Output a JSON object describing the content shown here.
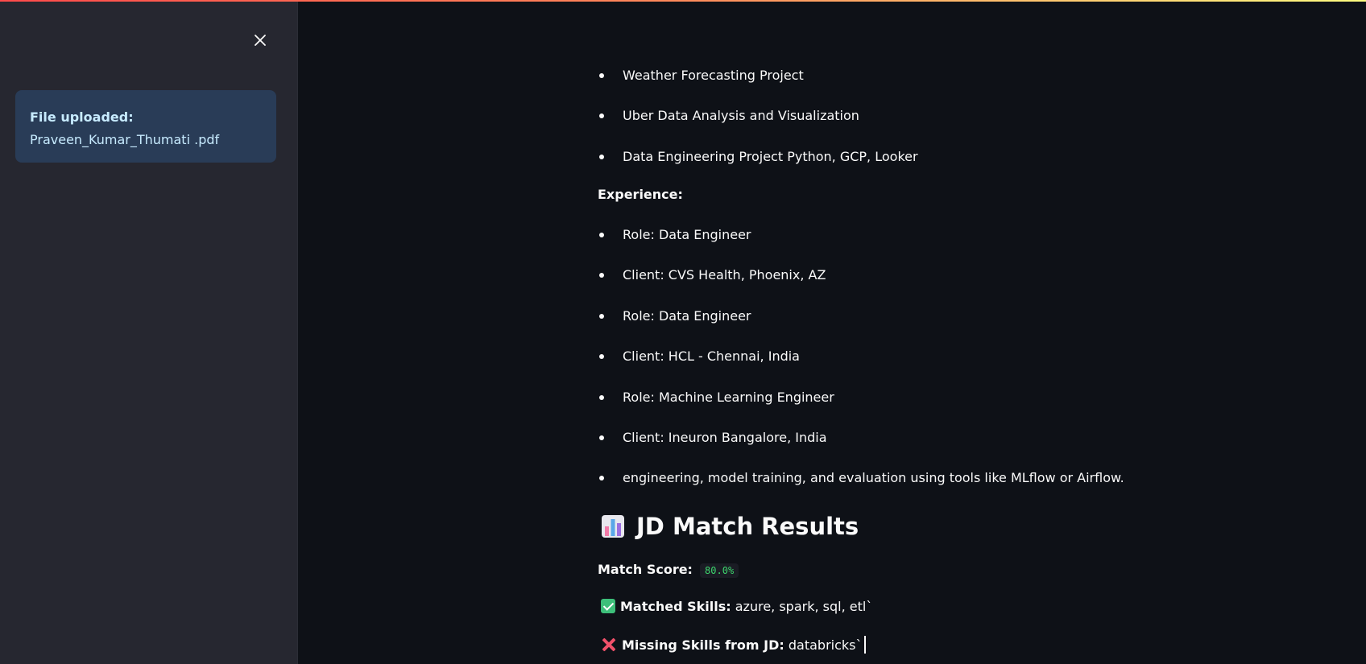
{
  "sidebar": {
    "upload": {
      "label": "File uploaded:",
      "filename": "Praveen_Kumar_Thumati .pdf"
    }
  },
  "projects": [
    "Weather Forecasting Project",
    "Uber Data Analysis and Visualization",
    "Data Engineering Project Python, GCP, Looker"
  ],
  "experience": {
    "heading": "Experience:",
    "items": [
      "Role: Data Engineer",
      "Client: CVS Health, Phoenix, AZ",
      "Role: Data Engineer",
      "Client: HCL - Chennai, India",
      "Role: Machine Learning Engineer",
      "Client: Ineuron Bangalore, India",
      "engineering, model training, and evaluation using tools like MLflow or Airflow."
    ]
  },
  "results": {
    "title": "JD Match Results",
    "title_icon": "bar-chart-icon",
    "match_score_label": "Match Score:",
    "match_score_value": "80.0%",
    "matched_label": "Matched Skills:",
    "matched_icon": "check-mark-icon",
    "matched_value": "azure, spark, sql, etl`",
    "missing_label": "Missing Skills from JD:",
    "missing_icon": "cross-mark-icon",
    "missing_value": "databricks`"
  },
  "colors": {
    "background": "#0e1117",
    "sidebar": "#262730",
    "upload_box": "#293c57",
    "upload_text": "#c7ebff",
    "score_text": "#3dd56d"
  }
}
